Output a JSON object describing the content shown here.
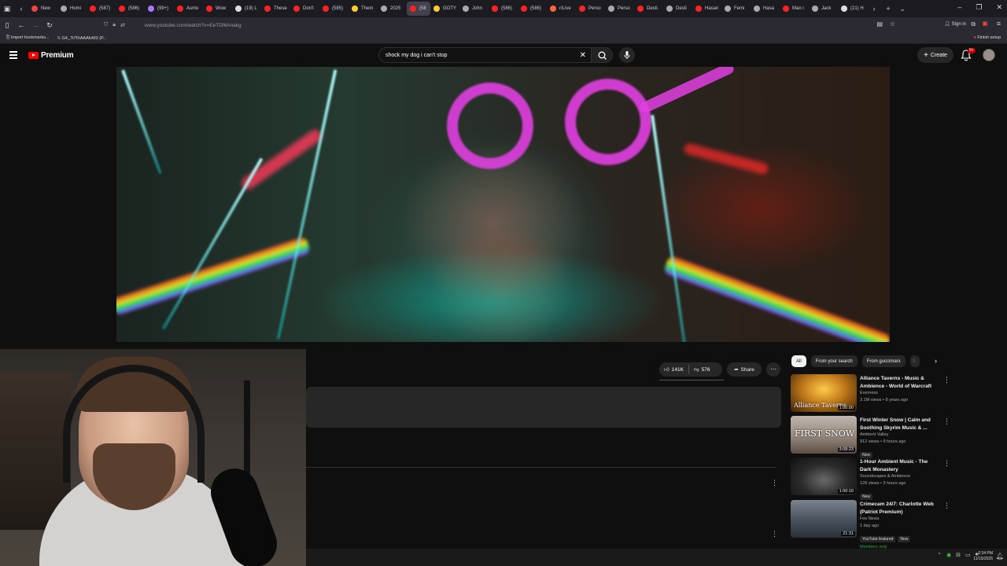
{
  "browser": {
    "tabs": [
      {
        "label": "New",
        "color": "#e44"
      },
      {
        "label": "Homi",
        "color": "#aaa"
      },
      {
        "label": "(587)",
        "color": "#f22"
      },
      {
        "label": "(586)",
        "color": "#f22"
      },
      {
        "label": "(99+)",
        "color": "#a7f"
      },
      {
        "label": "Asmo",
        "color": "#f22"
      },
      {
        "label": "Wow",
        "color": "#f22"
      },
      {
        "label": "(19) L",
        "color": "#ddd"
      },
      {
        "label": "These",
        "color": "#f22"
      },
      {
        "label": "Don't",
        "color": "#f22"
      },
      {
        "label": "(585)",
        "color": "#f22"
      },
      {
        "label": "Them",
        "color": "#fc3"
      },
      {
        "label": "2025",
        "color": "#aaa"
      },
      {
        "label": "(58",
        "color": "#f22",
        "active": true
      },
      {
        "label": "GOTY",
        "color": "#fc3"
      },
      {
        "label": "John",
        "color": "#aaa"
      },
      {
        "label": "(586)",
        "color": "#f22"
      },
      {
        "label": "(586)",
        "color": "#f22"
      },
      {
        "label": "r/Live",
        "color": "#f63"
      },
      {
        "label": "Perso",
        "color": "#f22"
      },
      {
        "label": "Perso",
        "color": "#aaa"
      },
      {
        "label": "Desti",
        "color": "#f22"
      },
      {
        "label": "Desti",
        "color": "#aaa"
      },
      {
        "label": "Hasan",
        "color": "#f22"
      },
      {
        "label": "Femi",
        "color": "#aaa"
      },
      {
        "label": "Hasa",
        "color": "#aaa"
      },
      {
        "label": "Man i",
        "color": "#f22"
      },
      {
        "label": "Jack",
        "color": "#aaa"
      },
      {
        "label": "(21) H",
        "color": "#ddd"
      }
    ],
    "url": "www.youtube.com/watch?v=EeTDf6Anakg",
    "sign_in": "Sign in",
    "bookmarks": [
      "Import bookmarks...",
      "G4_7t7fXAAAfvM3 (P..."
    ],
    "finish_setup": "Finish setup"
  },
  "youtube": {
    "logo_text": "Premium",
    "search_value": "shock my dog i can't stop",
    "create_label": "Create",
    "notif_count": "9+",
    "likes": "141K",
    "dislikes": "576",
    "share_label": "Share",
    "chips": [
      "All",
      "From your search",
      "From guccimarx",
      "S"
    ],
    "recommendations": [
      {
        "title": "Alliance Taverns - Music & Ambience - World of Warcraft",
        "channel": "Everness",
        "meta": "3.1M views • 8 years ago",
        "duration": "1:00:00",
        "thumb_text": "Alliance Taverns",
        "badges": []
      },
      {
        "title": "First Winter Snow | Calm and Soothing Skyrim Music & ...",
        "channel": "Ambient Valley",
        "meta": "912 views • 9 hours ago",
        "duration": "3:08:23",
        "thumb_text": "FIRST SNOW",
        "badges": [
          "New"
        ]
      },
      {
        "title": "1-Hour Ambient Music - The Dark Monastery",
        "channel": "Soundscapes & Ambience",
        "meta": "128 views • 3 hours ago",
        "duration": "1:00:10",
        "thumb_text": "",
        "badges": [
          "New"
        ]
      },
      {
        "title": "Crimecam 24/7: Charlotte Web (Patriot Premium)",
        "channel": "Fox News",
        "meta": "1 day ago",
        "duration": "21:31",
        "thumb_text": "",
        "badges": [
          "YouTube featured",
          "New"
        ],
        "members": "Members only"
      }
    ]
  },
  "taskbar": {
    "time": "2:34 PM",
    "date": "11/15/2025"
  }
}
